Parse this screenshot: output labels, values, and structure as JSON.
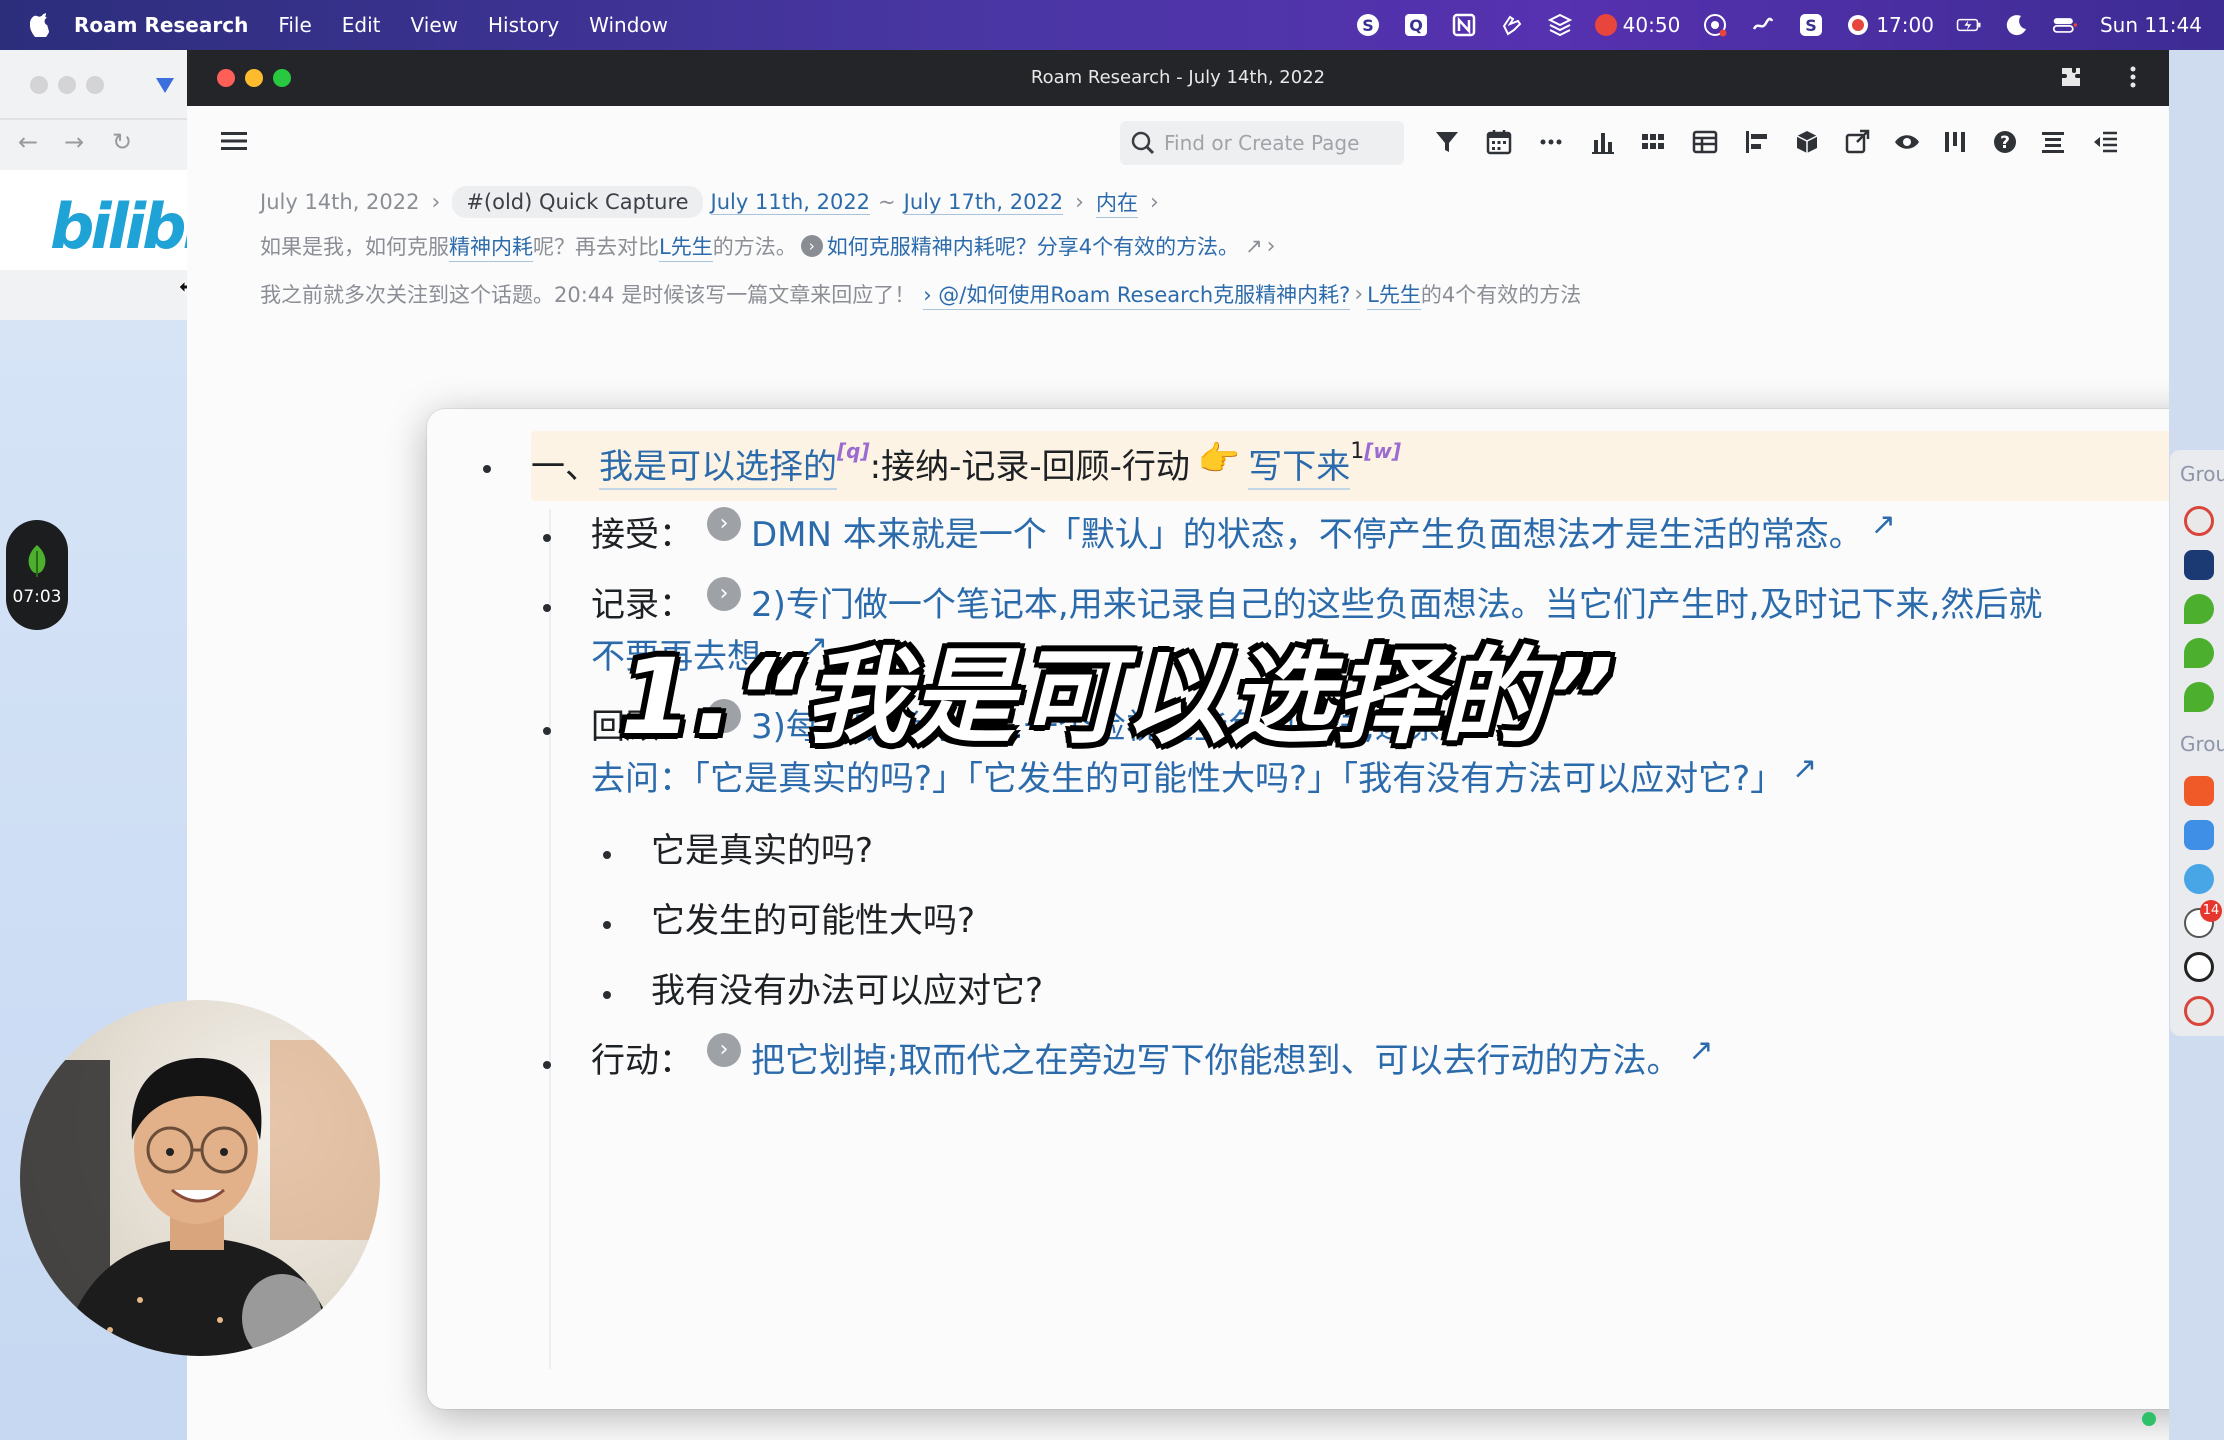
{
  "menubar": {
    "app_name": "Roam Research",
    "menus": [
      "File",
      "Edit",
      "View",
      "History",
      "Window"
    ],
    "pomodoro": "40:50",
    "timer": "17:00",
    "clock": "Sun 11:44"
  },
  "bg_window": {
    "logo": "bilibili",
    "timer_pill": "07:03"
  },
  "roam": {
    "window_title": "Roam Research - July 14th, 2022",
    "search_placeholder": "Find or Create Page",
    "breadcrumbs": {
      "date": "July 14th, 2022",
      "tag": "#(old) Quick Capture",
      "week_start": "July 11th, 2022",
      "tilde": "~",
      "week_end": "July 17th, 2022",
      "page": "内在"
    },
    "ref_line1": {
      "pre": "如果是我，如何克服",
      "link1": "精神内耗",
      "mid": "呢？再去对比",
      "link2": "L先生",
      "post": "的方法。",
      "ref_text": "如何克服精神内耗呢？分享4个有效的方法。"
    },
    "ref_line2": {
      "pre": "我之前就多次关注到这个话题。20:44 是时候该写一篇文章来回应了！",
      "link1": "› @/如何使用Roam Research克服精神内耗?",
      "link2_a": "L先生",
      "link2_b": "的4个有效的方法"
    },
    "card": {
      "top_prefix": "一、",
      "top_link": "我是可以选择的",
      "top_alias1": "[q]",
      "top_mid": ":接纳-记录-回顾-行动",
      "top_emoji": "👉",
      "top_link2": "写下来",
      "top_sup": "1",
      "top_alias2": "[w]",
      "ref_count": "1",
      "items": [
        {
          "label": "接受：",
          "ref": "DMN 本来就是一个「默认」的状态，不停产生负面想法才是生活的常态。"
        },
        {
          "label": "记录：",
          "ref": "2)专门做一个笔记本,用来记录自己的这些负面想法。当它们产生时,及时记下来,然后就",
          "ref_cont": "不要再去想。"
        },
        {
          "label": "回顾：",
          "ref": "3)每…或者每周…一个检视这些负面想法,逐条",
          "ref_cont": "去问：「它是真实的吗?」「它发生的可能性大吗?」「我有没有方法可以应对它?」"
        },
        {
          "label": "行动：",
          "ref": "把它划掉;取而代之在旁边写下你能想到、可以去行动的方法。"
        }
      ],
      "sub_items": [
        "它是真实的吗?",
        "它发生的可能性大吗?",
        "我有没有办法可以应对它?"
      ],
      "arrow": "↗"
    },
    "caption": "1.“我是可以选择的”"
  },
  "dock": {
    "group_label": "Grou",
    "badge": "14"
  }
}
